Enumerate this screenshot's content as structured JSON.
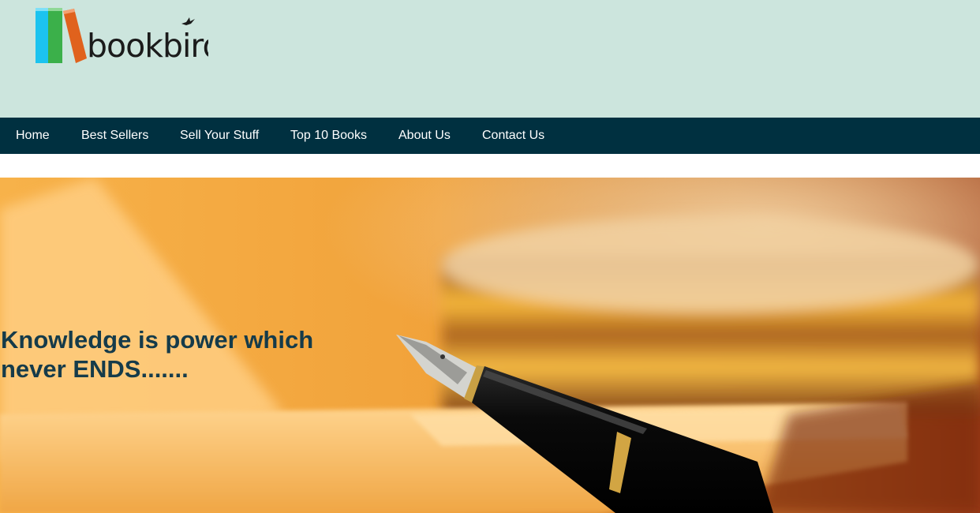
{
  "brand": {
    "name": "bookbird",
    "book_colors": [
      "#1cc3ef",
      "#3bb04a",
      "#e0621d"
    ]
  },
  "nav": {
    "items": [
      {
        "label": "Home"
      },
      {
        "label": "Best Sellers"
      },
      {
        "label": "Sell Your Stuff"
      },
      {
        "label": "Top 10 Books"
      },
      {
        "label": "About Us"
      },
      {
        "label": "Contact Us"
      }
    ]
  },
  "hero": {
    "tagline": "Knowledge is power which never ENDS.......",
    "image": "fountain-pen-on-open-book-warm-light"
  },
  "colors": {
    "header_bg": "#cce5dd",
    "nav_bg": "#003040",
    "tagline": "#153b4a"
  }
}
